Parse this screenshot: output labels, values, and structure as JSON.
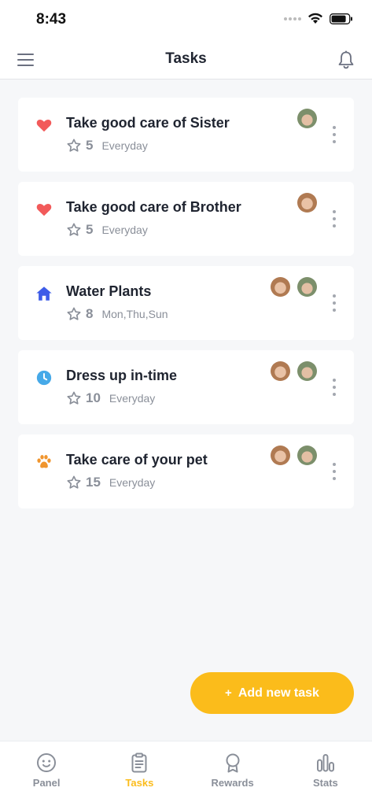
{
  "status_bar": {
    "time": "8:43"
  },
  "header": {
    "title": "Tasks"
  },
  "tasks": [
    {
      "title": "Take good care of Sister",
      "icon": "heart-icon",
      "icon_color": "#f25a5a",
      "points": "5",
      "frequency": "Everyday",
      "assignees": [
        "boy"
      ]
    },
    {
      "title": "Take good care of Brother",
      "icon": "heart-icon",
      "icon_color": "#f25a5a",
      "points": "5",
      "frequency": "Everyday",
      "assignees": [
        "girl"
      ]
    },
    {
      "title": "Water Plants",
      "icon": "home-icon",
      "icon_color": "#3d5ce8",
      "points": "8",
      "frequency": "Mon,Thu,Sun",
      "assignees": [
        "girl",
        "boy"
      ]
    },
    {
      "title": "Dress up in-time",
      "icon": "clock-icon",
      "icon_color": "#46a9e8",
      "points": "10",
      "frequency": "Everyday",
      "assignees": [
        "girl",
        "boy"
      ]
    },
    {
      "title": "Take care of your pet",
      "icon": "paw-icon",
      "icon_color": "#f0952e",
      "points": "15",
      "frequency": "Everyday",
      "assignees": [
        "girl",
        "boy"
      ]
    }
  ],
  "add_button": {
    "label": "Add new task",
    "icon": "+",
    "color": "#fbbc1b"
  },
  "tabs": [
    {
      "label": "Panel",
      "icon": "smile-icon",
      "active": false
    },
    {
      "label": "Tasks",
      "icon": "clipboard-icon",
      "active": true
    },
    {
      "label": "Rewards",
      "icon": "award-icon",
      "active": false
    },
    {
      "label": "Stats",
      "icon": "bar-chart-icon",
      "active": false
    }
  ],
  "colors": {
    "accent": "#fbbc1b",
    "text_primary": "#1f2430",
    "text_secondary": "#8a8f99",
    "background": "#f6f7f9"
  }
}
